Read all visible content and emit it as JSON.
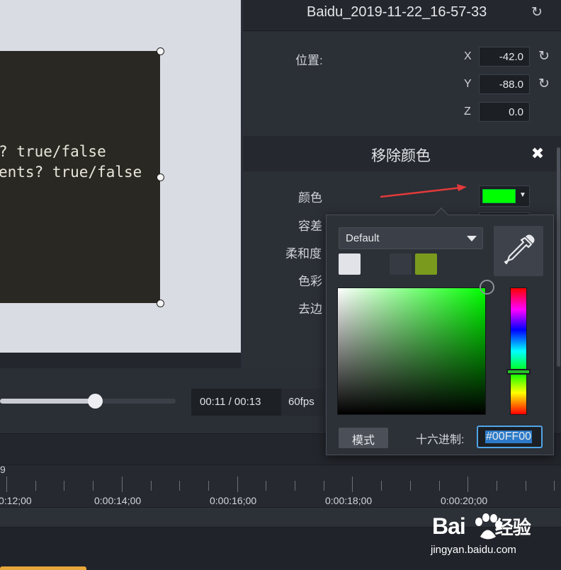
{
  "canvas": {
    "code_lines": [
      "? true/false",
      "ents? true/false"
    ]
  },
  "properties": {
    "clip_title": "Baidu_2019-11-22_16-57-33",
    "position_label": "位置:",
    "x_label": "X",
    "x_value": "-42.0",
    "y_label": "Y",
    "y_value": "-88.0",
    "z_label": "Z",
    "z_value": "0.0"
  },
  "effect": {
    "title": "移除颜色",
    "close_glyph": "✖",
    "color_label": "颜色",
    "tolerance_label": "容差",
    "softness_label": "柔和度",
    "hue_label": "色彩",
    "defringe_label": "去边",
    "selected_color": "#00FF00"
  },
  "color_picker": {
    "palette_selected": "Default",
    "swatches": [
      "#e1e3e8",
      "#2c3037",
      "#363b43",
      "#7a9a1e"
    ],
    "current_hex": "#00FF00",
    "mode_button_label": "模式",
    "hex_label": "十六进制:",
    "eyedropper_icon": "eyedropper-icon"
  },
  "playback": {
    "time_display": "00:11 / 00:13",
    "fps": "60fps",
    "progress": 0.54
  },
  "timeline": {
    "ruler_fragment": "9",
    "ticks": [
      "0:12;00",
      "0:00:14;00",
      "0:00:16;00",
      "0:00:18;00",
      "0:00:20;00"
    ]
  },
  "watermark": {
    "logo_text": "Bai",
    "logo_suffix": "经验",
    "url": "jingyan.baidu.com"
  }
}
